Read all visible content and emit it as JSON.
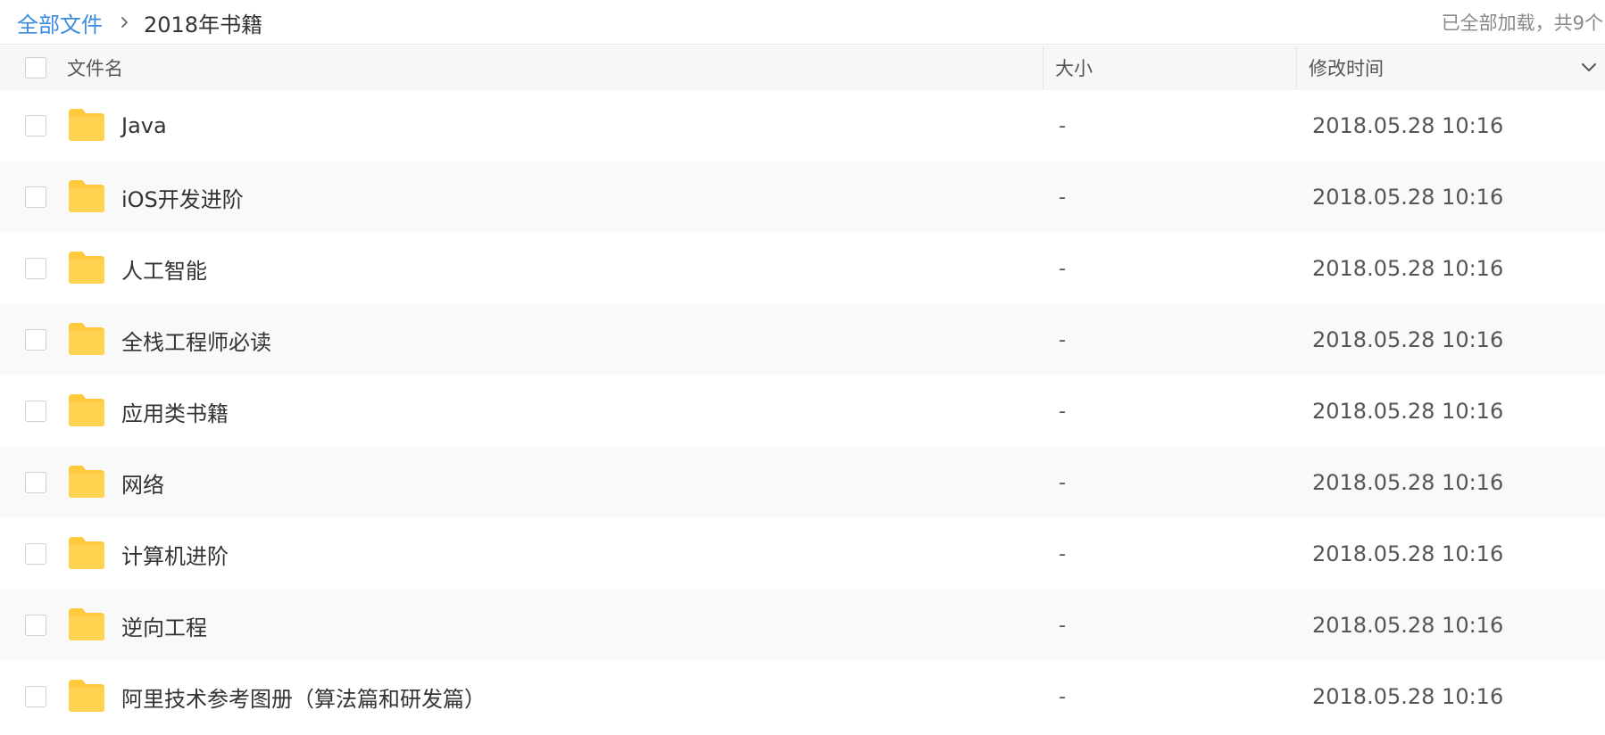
{
  "breadcrumb": {
    "root": "全部文件",
    "current": "2018年书籍"
  },
  "status": "已全部加载，共9个",
  "columns": {
    "name": "文件名",
    "size": "大小",
    "modified": "修改时间"
  },
  "colors": {
    "link": "#3b8cde",
    "folder": "#ffd34f",
    "folder_tab": "#ffc83d",
    "row_alt": "#f9f9f9"
  },
  "files": [
    {
      "name": "Java",
      "size": "-",
      "modified": "2018.05.28 10:16",
      "icon": "folder-icon"
    },
    {
      "name": "iOS开发进阶",
      "size": "-",
      "modified": "2018.05.28 10:16",
      "icon": "folder-icon"
    },
    {
      "name": "人工智能",
      "size": "-",
      "modified": "2018.05.28 10:16",
      "icon": "folder-icon"
    },
    {
      "name": "全栈工程师必读",
      "size": "-",
      "modified": "2018.05.28 10:16",
      "icon": "folder-icon"
    },
    {
      "name": "应用类书籍",
      "size": "-",
      "modified": "2018.05.28 10:16",
      "icon": "folder-icon"
    },
    {
      "name": "网络",
      "size": "-",
      "modified": "2018.05.28 10:16",
      "icon": "folder-icon"
    },
    {
      "name": "计算机进阶",
      "size": "-",
      "modified": "2018.05.28 10:16",
      "icon": "folder-icon"
    },
    {
      "name": "逆向工程",
      "size": "-",
      "modified": "2018.05.28 10:16",
      "icon": "folder-icon"
    },
    {
      "name": "阿里技术参考图册（算法篇和研发篇）",
      "size": "-",
      "modified": "2018.05.28 10:16",
      "icon": "folder-icon"
    }
  ]
}
